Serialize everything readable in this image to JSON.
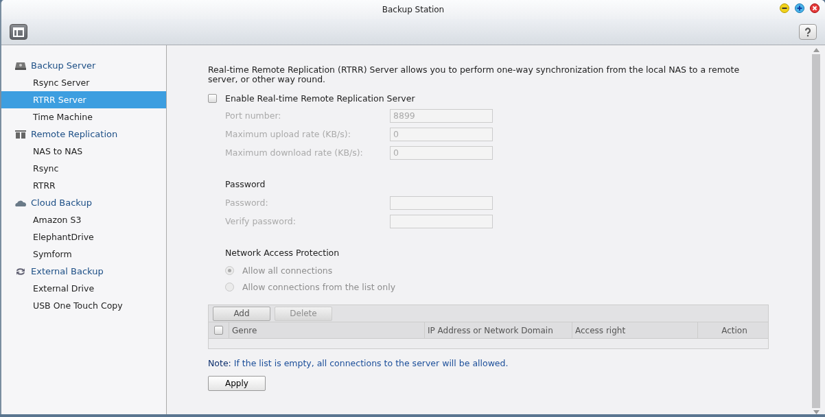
{
  "window": {
    "title": "Backup Station"
  },
  "sidebar": {
    "groups": [
      {
        "label": "Backup Server",
        "kind": "drive",
        "children": [
          {
            "label": "Rsync Server",
            "selected": false
          },
          {
            "label": "RTRR Server",
            "selected": true
          },
          {
            "label": "Time Machine",
            "selected": false
          }
        ]
      },
      {
        "label": "Remote Replication",
        "kind": "servers",
        "children": [
          {
            "label": "NAS to NAS",
            "selected": false
          },
          {
            "label": "Rsync",
            "selected": false
          },
          {
            "label": "RTRR",
            "selected": false
          }
        ]
      },
      {
        "label": "Cloud Backup",
        "kind": "cloud",
        "children": [
          {
            "label": "Amazon S3",
            "selected": false
          },
          {
            "label": "ElephantDrive",
            "selected": false
          },
          {
            "label": "Symform",
            "selected": false
          }
        ]
      },
      {
        "label": "External Backup",
        "kind": "sync",
        "children": [
          {
            "label": "External Drive",
            "selected": false
          },
          {
            "label": "USB One Touch Copy",
            "selected": false
          }
        ]
      }
    ]
  },
  "content": {
    "description": "Real-time Remote Replication (RTRR) Server allows you to perform one-way synchronization from the local NAS to a remote server, or other way round.",
    "enable": {
      "label": "Enable Real-time Remote Replication Server",
      "checked": false
    },
    "fields": [
      {
        "label": "Port number:",
        "value": "8899",
        "disabled": true
      },
      {
        "label": "Maximum upload rate (KB/s):",
        "value": "0",
        "disabled": true
      },
      {
        "label": "Maximum download rate (KB/s):",
        "value": "0",
        "disabled": true
      }
    ],
    "password_section": {
      "title": "Password",
      "fields": [
        {
          "label": "Password:",
          "disabled": true
        },
        {
          "label": "Verify password:",
          "disabled": true
        }
      ]
    },
    "access_section": {
      "title": "Network Access Protection",
      "options": [
        {
          "label": "Allow all connections",
          "selected": true,
          "disabled": true
        },
        {
          "label": "Allow connections from the list only",
          "selected": false,
          "disabled": true
        }
      ]
    },
    "table": {
      "buttons": [
        {
          "label": "Add",
          "disabled": false
        },
        {
          "label": "Delete",
          "disabled": true
        }
      ],
      "select_all_checked": false,
      "columns": [
        "Genre",
        "IP Address or Network Domain",
        "Access right",
        "Action"
      ]
    },
    "note": "**Note:** If the list is empty, all connections to the server will be allowed.",
    "apply_button": "Apply"
  }
}
